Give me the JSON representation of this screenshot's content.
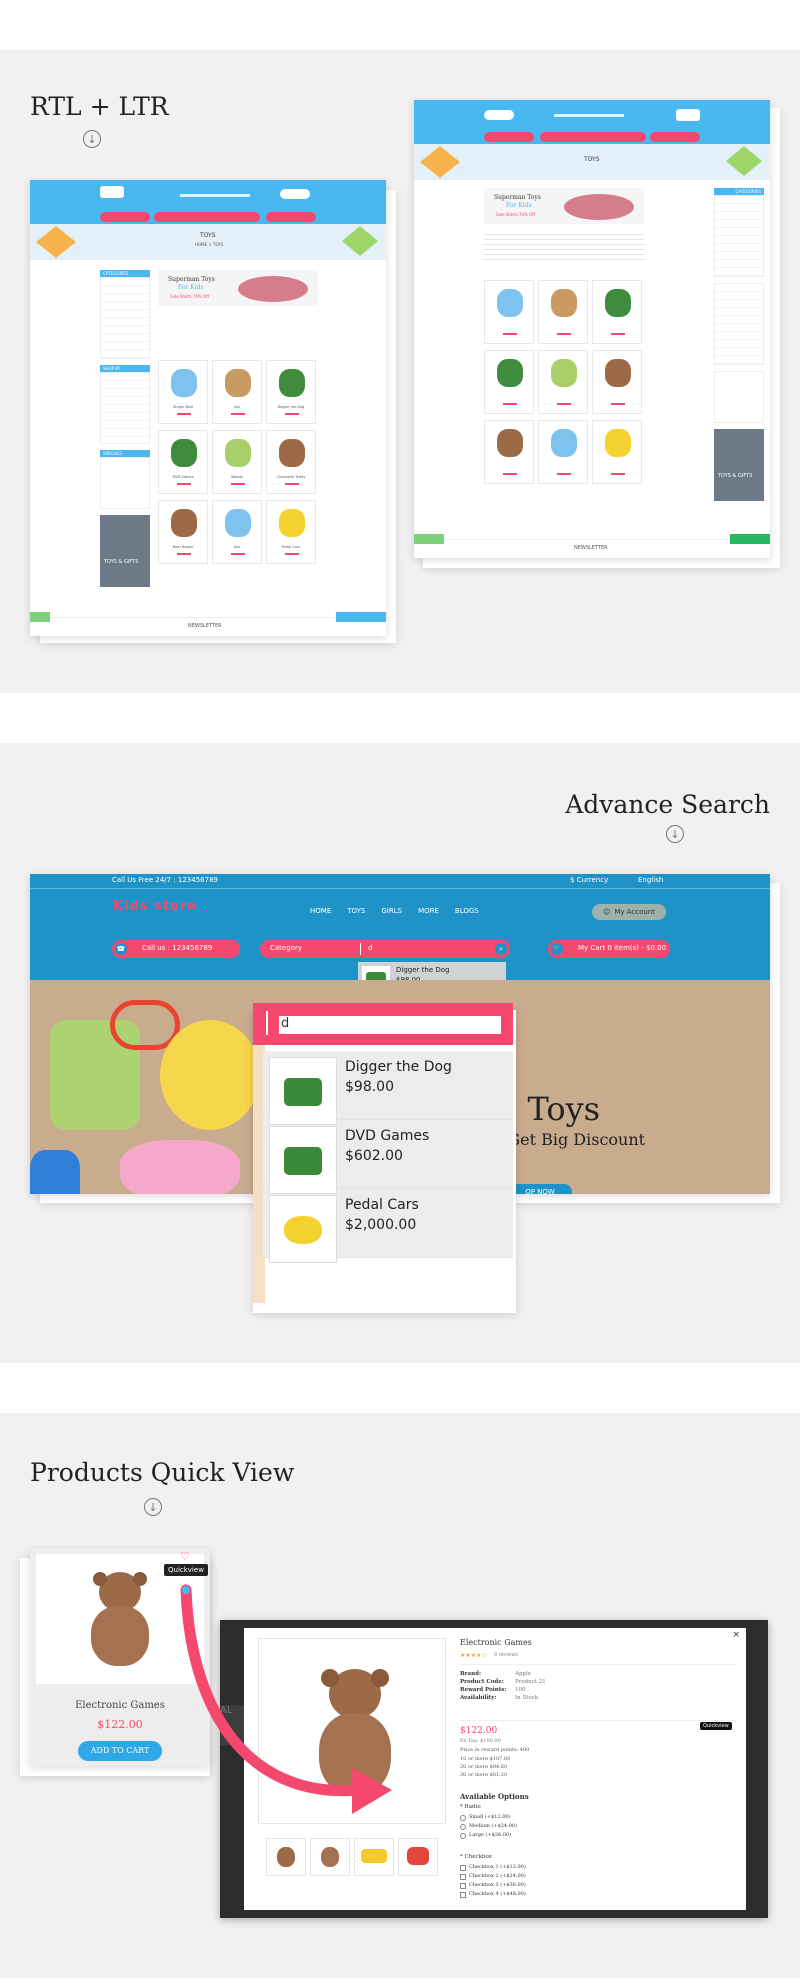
{
  "sections": {
    "rtl_ltr": {
      "title": "RTL + LTR"
    },
    "advance_search": {
      "title": "Advance Search"
    },
    "quick_view": {
      "title": "Products Quick View"
    }
  },
  "ltr_shot": {
    "hero_title": "TOYS",
    "hero_crumb": "HOME > TOYS",
    "banner_title": "Superman Toys",
    "banner_sub": "For Kids",
    "banner_sale": "Sale Starts 70% Off",
    "sidebar_head": "CATEGORIES",
    "shop_head": "SHOP BY",
    "specials_head": "SPECIALS",
    "promo": "TOYS & GIFTS",
    "newsletter": "NEWSLETTER",
    "products": [
      "Ginger Blue",
      "Jinx",
      "Digger the Dog",
      "DVD Games",
      "Woody",
      "Chocolate Teddy",
      "Bear Brown",
      "Jinx",
      "Pedal Cars"
    ]
  },
  "rtl_shot": {
    "hero_title": "TOYS",
    "banner_title": "Superman Toys",
    "banner_sub": "For Kids",
    "banner_sale": "Sale Starts 70% Off",
    "sidebar_head": "CATEGORIES",
    "promo": "TOYS & GIFTS",
    "newsletter": "NEWSLETTER"
  },
  "search_shot": {
    "call_free": "Call Us Free 24/7 : 123456789",
    "currency": "$ Currency",
    "language": "English",
    "logo": "Kids store",
    "nav": [
      "HOME",
      "TOYS",
      "GIRLS",
      "MORE",
      "BLOGS"
    ],
    "account": "My Account",
    "call_pill": "Call us : 123456789",
    "category": "Category",
    "query": "d",
    "cart": "My Cart 0 item(s) - $0.00",
    "mini_result_name": "Digger the Dog",
    "mini_result_price": "$98.00",
    "hero_line1": "ts Toys",
    "hero_line2": "& Get Big Discount",
    "hero_btn": "OP NOW",
    "results": [
      {
        "name": "Digger the Dog",
        "price": "$98.00"
      },
      {
        "name": "DVD Games",
        "price": "$602.00"
      },
      {
        "name": "Pedal Cars",
        "price": "$2,000.00"
      }
    ]
  },
  "quick_card": {
    "badge": "Quickview",
    "name": "Electronic Games",
    "price": "$122.00",
    "button": "ADD TO CART"
  },
  "modal": {
    "title": "Electronic Games",
    "reviews": "0 reviews",
    "specs": [
      {
        "k": "Brand:",
        "v": "Apple"
      },
      {
        "k": "Product Code:",
        "v": "Product 21"
      },
      {
        "k": "Reward Points:",
        "v": "100"
      },
      {
        "k": "Availability:",
        "v": "In Stock"
      }
    ],
    "price": "$122.00",
    "ex_tax": "Ex Tax: $100.00",
    "reward_line": "Price in reward points: 400",
    "discounts": [
      "10 or more $107.60",
      "20 or more $94.60",
      "30 or more $81.20"
    ],
    "options_head": "Available Options",
    "radio_head": "* Radio",
    "radio_opts": [
      "Small (+$12.00)",
      "Medium (+$24.00)",
      "Large (+$36.00)"
    ],
    "check_head": "* Checkbox",
    "check_opts": [
      "Checkbox 1 (+$12.00)",
      "Checkbox 2 (+$24.00)",
      "Checkbox 3 (+$36.00)",
      "Checkbox 4 (+$48.00)"
    ],
    "tooltip": "Quickview",
    "close": "×"
  }
}
